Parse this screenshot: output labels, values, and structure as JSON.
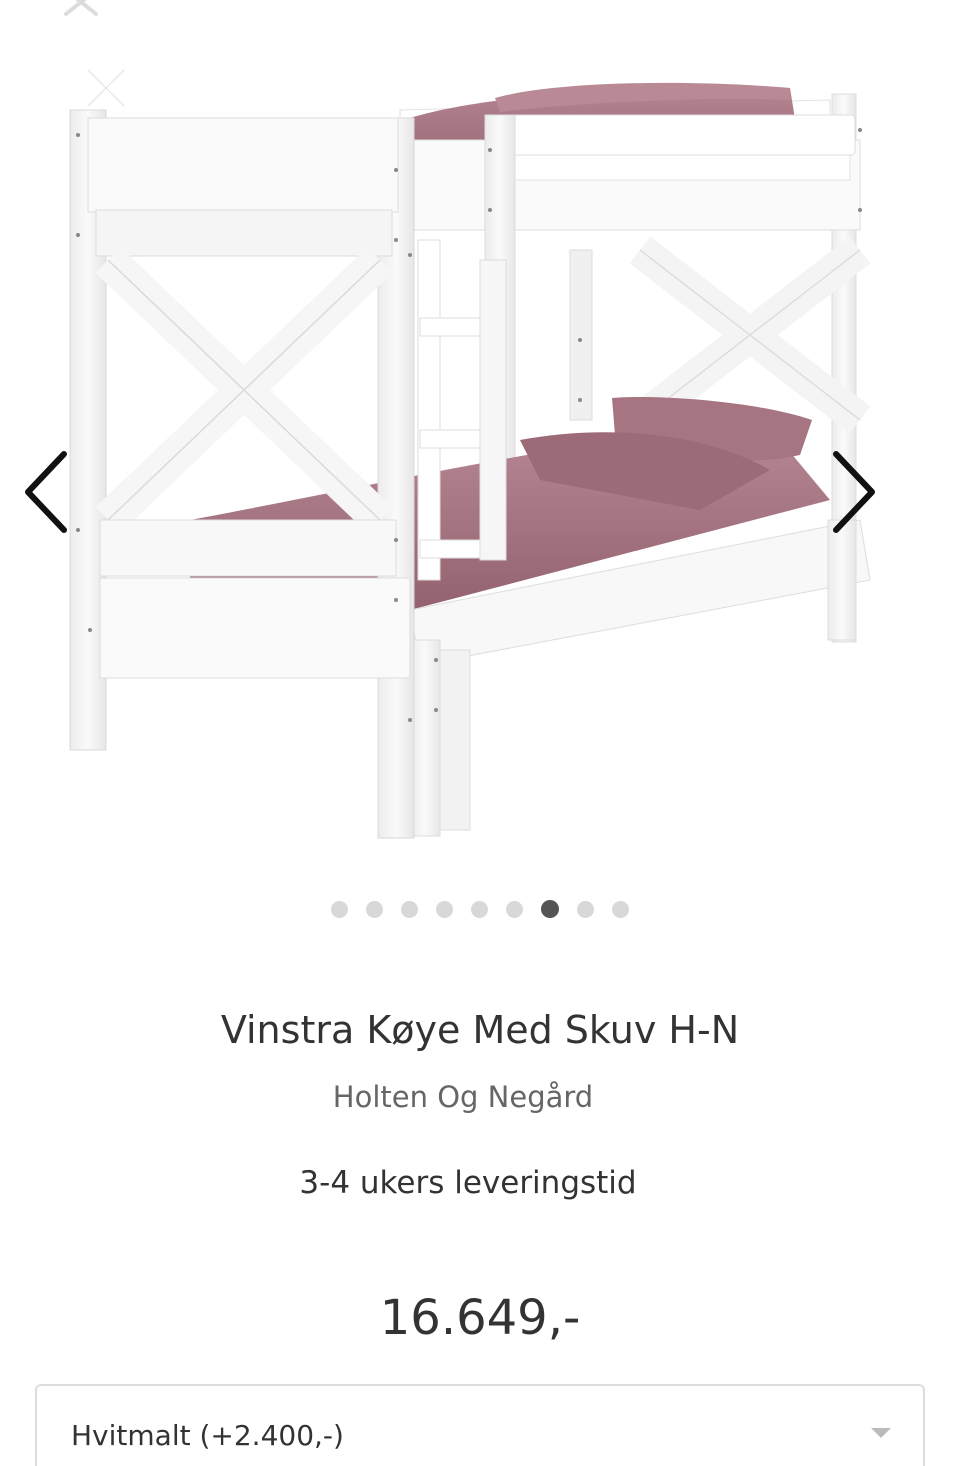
{
  "product": {
    "title": "Vinstra Køye Med Skuv H-N",
    "brand": "Holten Og Negård",
    "delivery": "3-4 ukers leveringstid",
    "price": "16.649,-"
  },
  "gallery": {
    "image_count": 9,
    "active_index": 6,
    "icons": {
      "close": "close-icon",
      "previous": "chevron-left-icon",
      "next": "chevron-right-icon"
    }
  },
  "variant": {
    "selected": "Hvitmalt (+2.400,-)",
    "icon": "caret-down-icon"
  },
  "colors": {
    "frame": "#f7f7f7",
    "bedding": "#a0707c",
    "text": "#333333",
    "dot_inactive": "#d8d8d8",
    "dot_active": "#555555"
  }
}
